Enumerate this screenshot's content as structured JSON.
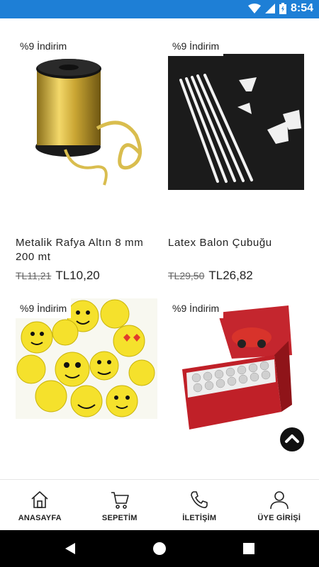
{
  "status_bar": {
    "time": "8:54"
  },
  "products": [
    {
      "discount": "%9 İndirim",
      "title": "Metalik Rafya Altın 8 mm 200 mt",
      "old_price": "TL11,21",
      "new_price": "TL10,20"
    },
    {
      "discount": "%9 İndirim",
      "title": "Latex Balon Çubuğu",
      "old_price": "TL29,50",
      "new_price": "TL26,82"
    },
    {
      "discount": "%9 İndirim"
    },
    {
      "discount": "%9 İndirim"
    }
  ],
  "bottom_nav": [
    {
      "label": "ANASAYFA",
      "icon": "home-icon"
    },
    {
      "label": "SEPETİM",
      "icon": "cart-icon"
    },
    {
      "label": "İLETİŞİM",
      "icon": "phone-icon"
    },
    {
      "label": "ÜYE GİRİŞİ",
      "icon": "user-icon"
    }
  ],
  "colors": {
    "status_bar": "#1e7fd6",
    "gold": "#d4b23a",
    "emoji_yellow": "#f5e12c"
  }
}
